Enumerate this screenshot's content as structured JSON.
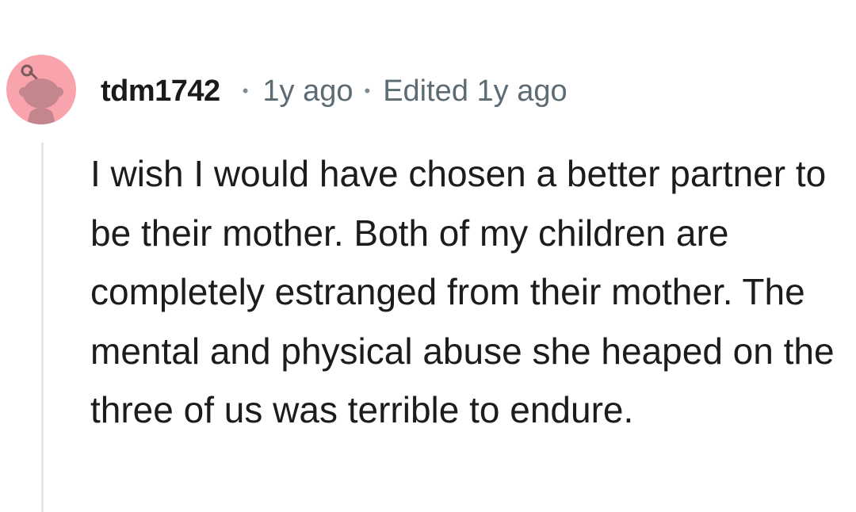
{
  "comment": {
    "avatar_icon": "reddit-snoo-avatar-icon",
    "avatar_color": "#f9a3ad",
    "username": "tdm1742",
    "separator": "•",
    "posted": "1y ago",
    "edited": "Edited 1y ago",
    "body": "I wish I would have chosen a better partner to be their mother. Both of my children are completely estranged from their mother. The mental and physical abuse she heaped on the three of us was terrible to endure."
  }
}
